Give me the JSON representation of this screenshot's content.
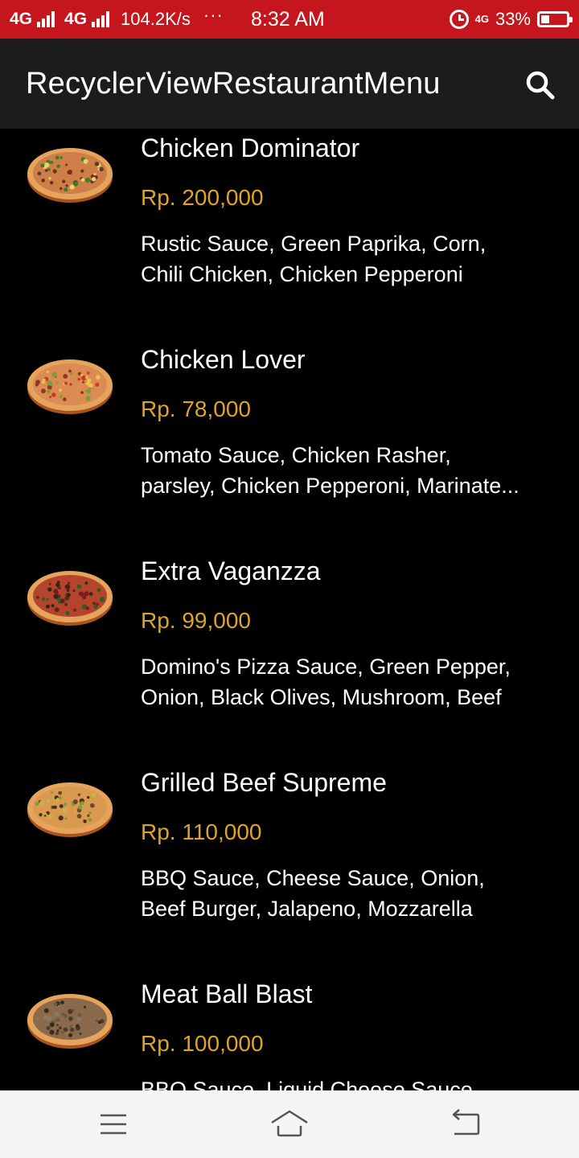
{
  "status_bar": {
    "network_1": "4G",
    "network_2": "4G",
    "speed": "104.2K/s",
    "dots": "···",
    "time": "8:32 AM",
    "lte_label": "4G",
    "battery_percent": "33%",
    "battery_level": 0.33
  },
  "app_bar": {
    "title": "RecyclerViewRestaurantMenu",
    "search_icon": "search-icon"
  },
  "menu": {
    "items": [
      {
        "name": "Chicken Dominator",
        "price": "Rp. 200,000",
        "desc_line_1": "Rustic Sauce, Green Paprika, Corn,",
        "desc_line_2": "Chili Chicken, Chicken Pepperoni",
        "thumbnail": "pizza-image"
      },
      {
        "name": "Chicken Lover",
        "price": "Rp. 78,000",
        "desc_line_1": "Tomato Sauce, Chicken Rasher,",
        "desc_line_2": "parsley, Chicken Pepperoni, Marinate...",
        "thumbnail": "pizza-image"
      },
      {
        "name": "Extra Vaganzza",
        "price": "Rp. 99,000",
        "desc_line_1": "Domino's Pizza Sauce, Green Pepper,",
        "desc_line_2": "Onion, Black Olives, Mushroom, Beef",
        "thumbnail": "pizza-image"
      },
      {
        "name": "Grilled Beef Supreme",
        "price": "Rp. 110,000",
        "desc_line_1": "BBQ Sauce, Cheese Sauce, Onion,",
        "desc_line_2": "Beef Burger, Jalapeno, Mozzarella",
        "thumbnail": "pizza-image"
      },
      {
        "name": "Meat Ball Blast",
        "price": "Rp. 100,000",
        "desc_line_1": "BBQ Sauce, Liquid Cheese Sauce,",
        "desc_line_2": "",
        "thumbnail": "pizza-image"
      }
    ]
  },
  "nav_bar": {
    "menu_icon": "menu-icon",
    "home_icon": "home-icon",
    "back_icon": "back-icon"
  },
  "colors": {
    "status_bar": "#c4161c",
    "app_bar": "#1c1c1c",
    "background": "#000000",
    "price": "#e0a520",
    "text": "#ffffff",
    "nav_bar": "#f5f5f5"
  }
}
